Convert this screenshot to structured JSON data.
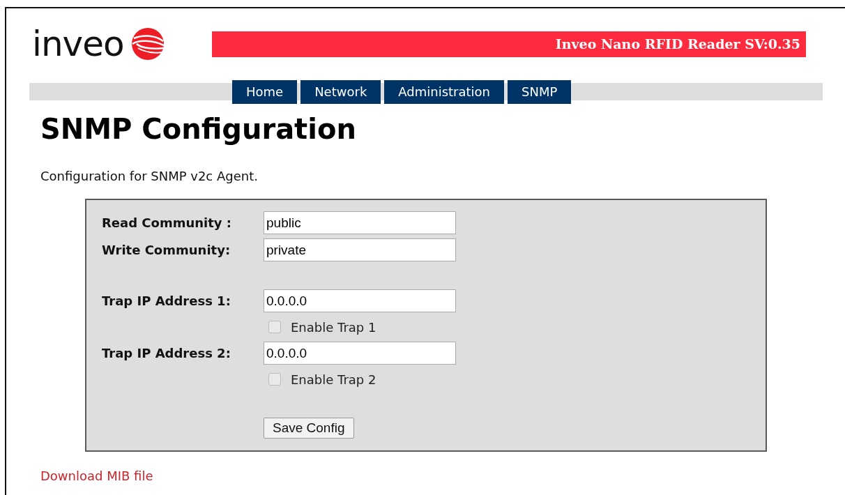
{
  "logo": {
    "text": "inveo"
  },
  "banner": {
    "title": "Inveo Nano RFID Reader SV:0.35"
  },
  "nav": [
    {
      "label": "Home"
    },
    {
      "label": "Network"
    },
    {
      "label": "Administration"
    },
    {
      "label": "SNMP"
    }
  ],
  "page": {
    "title": "SNMP Configuration",
    "description": "Configuration for SNMP v2c Agent."
  },
  "form": {
    "rows": [
      {
        "kind": "field",
        "label": "Read Community :",
        "value": "public"
      },
      {
        "kind": "field",
        "label": "Write Community:",
        "value": "private"
      },
      {
        "kind": "spacer"
      },
      {
        "kind": "field",
        "label": "Trap IP Address 1:",
        "value": "0.0.0.0"
      },
      {
        "kind": "checkbox",
        "label": "Enable Trap 1",
        "checked": false
      },
      {
        "kind": "field",
        "label": "Trap IP Address 2:",
        "value": "0.0.0.0"
      },
      {
        "kind": "checkbox",
        "label": "Enable Trap 2",
        "checked": false
      },
      {
        "kind": "spacer"
      },
      {
        "kind": "button",
        "label": "Save Config"
      }
    ]
  },
  "link": {
    "label": "Download MIB file"
  }
}
